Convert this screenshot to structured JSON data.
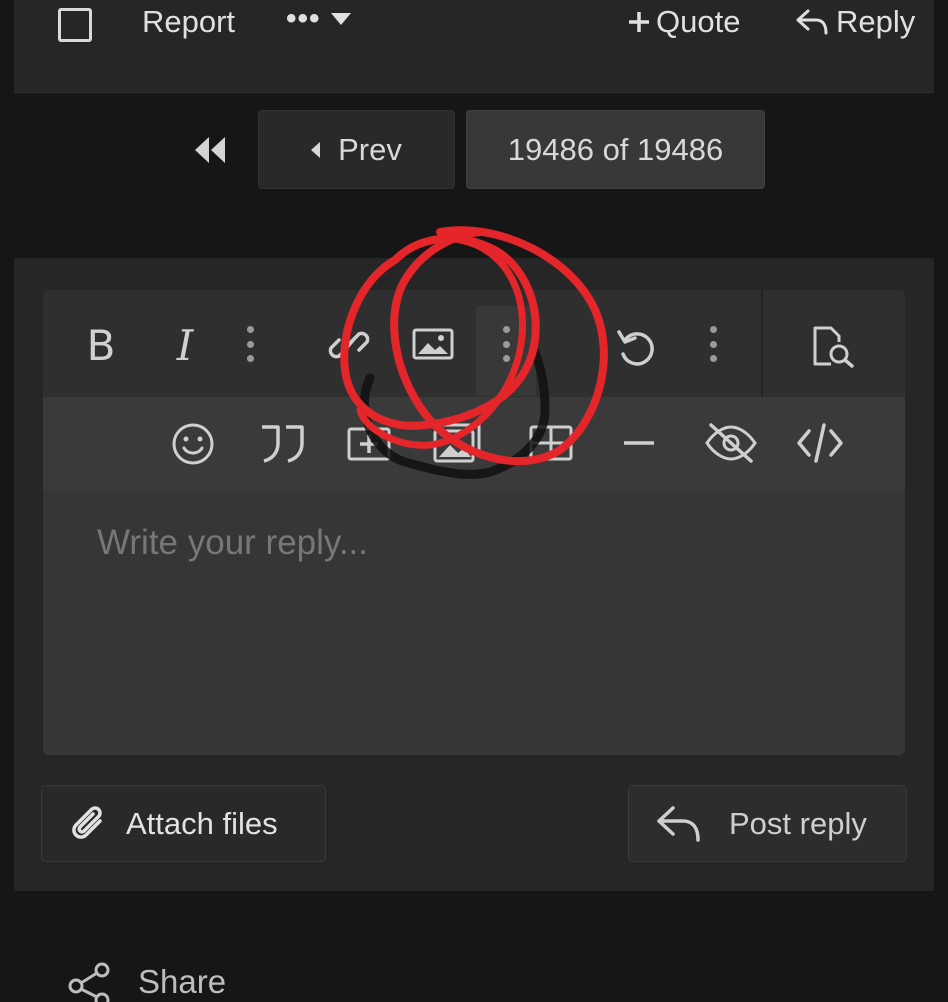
{
  "post_actions": {
    "report_label": "Report",
    "more_label": "•••",
    "quote_label": "Quote",
    "reply_label": "Reply"
  },
  "pagination": {
    "prev_label": "Prev",
    "current_label": "19486 of 19486"
  },
  "editor": {
    "bold_label": "B",
    "italic_label": "I",
    "placeholder": "Write your reply..."
  },
  "buttons": {
    "attach_label": "Attach files",
    "post_label": "Post reply"
  },
  "footer": {
    "share_label": "Share"
  },
  "colors": {
    "annotation_red": "#e4262b",
    "background": "#161616",
    "panel": "#262626"
  }
}
